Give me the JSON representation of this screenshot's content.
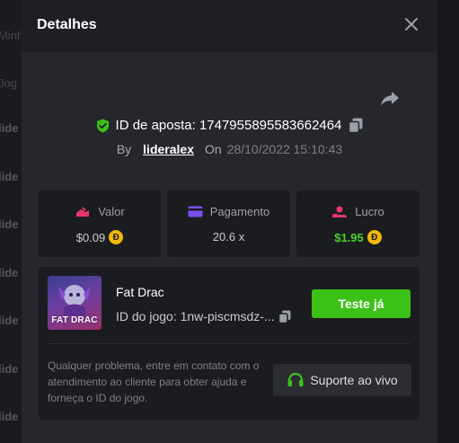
{
  "background": {
    "items": [
      {
        "text": "Minh",
        "light": true
      },
      {
        "text": "Jog",
        "light": true
      },
      {
        "text": "lide",
        "light": false
      },
      {
        "text": "lide",
        "light": false
      },
      {
        "text": "lide",
        "light": false
      },
      {
        "text": "lide",
        "light": false
      },
      {
        "text": "lide",
        "light": false
      },
      {
        "text": "lide",
        "light": false
      },
      {
        "text": "lide",
        "light": false
      },
      {
        "text": "lide",
        "light": false
      }
    ]
  },
  "modal": {
    "title": "Detalhes",
    "close_icon": "close-icon",
    "share_icon": "share-icon"
  },
  "bet": {
    "id_label": "ID de aposta: 1747955895583662464",
    "by_label": "By",
    "user": "lideralex",
    "on_label": "On",
    "date": "28/10/2022 15:10:43"
  },
  "stats": [
    {
      "label": "Valor",
      "value": "$0.09",
      "icon": "bet-value-icon",
      "color": "#e8366f",
      "value_green": false
    },
    {
      "label": "Pagamento",
      "value": "20.6 x",
      "icon": "payout-card-icon",
      "color": "#7b4ef0",
      "value_green": false
    },
    {
      "label": "Lucro",
      "value": "$1.95",
      "icon": "profit-hand-icon",
      "color": "#e8366f",
      "value_green": true
    }
  ],
  "coin_symbol": "Đ",
  "game": {
    "thumbnail_text": "FAT DRAC",
    "name": "Fat Drac",
    "id_label": "ID do jogo: 1nw-piscmsdz-...",
    "try_button": "Teste já",
    "help_text": "Qualquer problema, entre em contato com o atendimento ao cliente para obter ajuda e forneça o ID do jogo.",
    "support_button": "Suporte ao vivo"
  },
  "colors": {
    "accent_green": "#3bc117",
    "shield_green": "#3bc117",
    "coin": "#f0b90b"
  }
}
